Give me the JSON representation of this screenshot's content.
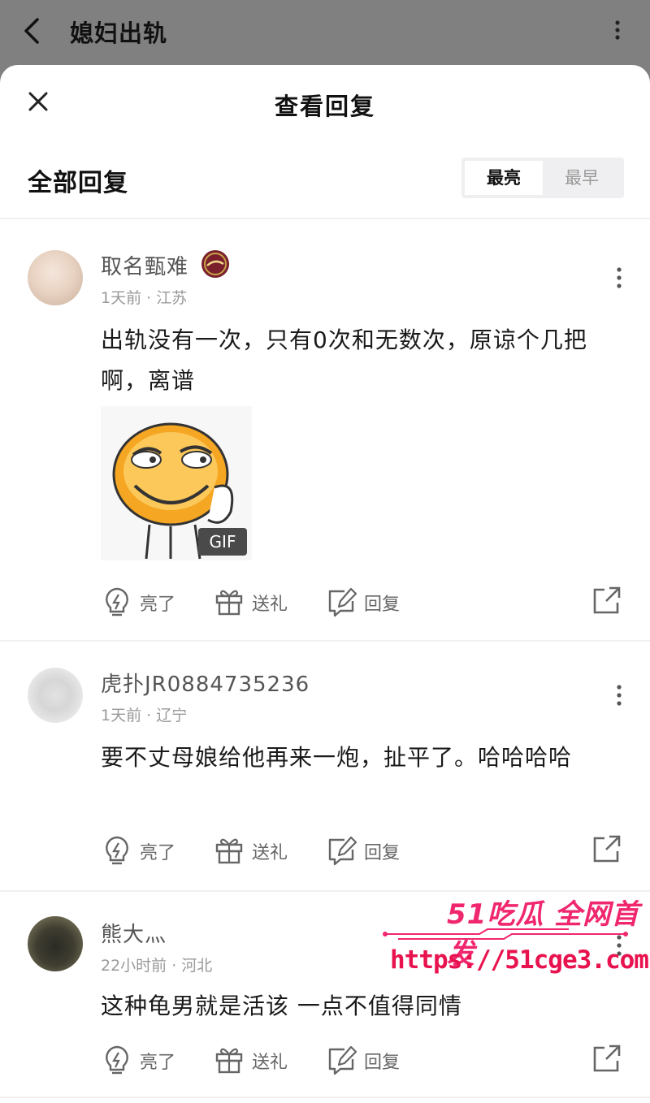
{
  "topbar": {
    "title": "媳妇出轨"
  },
  "sheet": {
    "title": "查看回复"
  },
  "section": {
    "title": "全部回复",
    "sort_active": "最亮",
    "sort_inactive": "最早"
  },
  "actions": {
    "like": "亮了",
    "gift": "送礼",
    "reply": "回复"
  },
  "comments": [
    {
      "username": "取名甄难",
      "meta": "1天前 · 江苏",
      "content": "出轨没有一次，只有0次和无数次，原谅个几把啊，离谱",
      "badge": "Cavaliers",
      "media_label": "GIF"
    },
    {
      "username": "虎扑JR0884735236",
      "meta": "1天前 · 辽宁",
      "content": "要不丈母娘给他再来一炮，扯平了。哈哈哈哈"
    },
    {
      "username": "熊大灬",
      "meta": "22小时前 · 河北",
      "content": "这种龟男就是活该 一点不值得同情"
    }
  ],
  "watermark": {
    "title": "51吃瓜 全网首发",
    "url": "https://51cge3.com"
  },
  "colors": {
    "accent": "#f0266e",
    "text_primary": "#111111",
    "text_secondary": "#999999"
  }
}
